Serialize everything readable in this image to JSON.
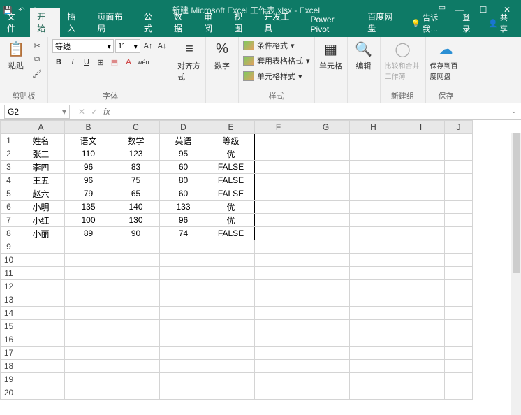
{
  "title": "新建 Microsoft Excel 工作表.xlsx - Excel",
  "tabs": [
    "文件",
    "开始",
    "插入",
    "页面布局",
    "公式",
    "数据",
    "审阅",
    "视图",
    "开发工具",
    "Power Pivot",
    "百度网盘"
  ],
  "active_tab": 1,
  "tell_me": "告诉我…",
  "login": "登录",
  "share": "共享",
  "ribbon": {
    "clipboard": {
      "paste": "粘贴",
      "label": "剪贴板"
    },
    "font": {
      "name": "等线",
      "size": "11",
      "label": "字体"
    },
    "align": {
      "big": "对齐方式"
    },
    "number": {
      "big": "数字"
    },
    "styles": {
      "c1": "条件格式",
      "c2": "套用表格格式",
      "c3": "单元格样式",
      "label": "样式"
    },
    "cells": {
      "big": "单元格"
    },
    "editing": {
      "big": "编辑"
    },
    "newgrp": {
      "big": "比较和合并工作簿",
      "label": "新建组"
    },
    "save": {
      "big": "保存到百度网盘",
      "label": "保存"
    }
  },
  "namebox": "G2",
  "columns": [
    "A",
    "B",
    "C",
    "D",
    "E",
    "F",
    "G",
    "H",
    "I",
    "J"
  ],
  "row_count": 20,
  "data": {
    "1": [
      "姓名",
      "语文",
      "数学",
      "英语",
      "等级"
    ],
    "2": [
      "张三",
      "110",
      "123",
      "95",
      "优"
    ],
    "3": [
      "李四",
      "96",
      "83",
      "60",
      "FALSE"
    ],
    "4": [
      "王五",
      "96",
      "75",
      "80",
      "FALSE"
    ],
    "5": [
      "赵六",
      "79",
      "65",
      "60",
      "FALSE"
    ],
    "6": [
      "小明",
      "135",
      "140",
      "133",
      "优"
    ],
    "7": [
      "小红",
      "100",
      "130",
      "96",
      "优"
    ],
    "8": [
      "小丽",
      "89",
      "90",
      "74",
      "FALSE"
    ]
  },
  "chart_data": {
    "type": "table",
    "columns": [
      "姓名",
      "语文",
      "数学",
      "英语",
      "等级"
    ],
    "rows": [
      [
        "张三",
        110,
        123,
        95,
        "优"
      ],
      [
        "李四",
        96,
        83,
        60,
        "FALSE"
      ],
      [
        "王五",
        96,
        75,
        80,
        "FALSE"
      ],
      [
        "赵六",
        79,
        65,
        60,
        "FALSE"
      ],
      [
        "小明",
        135,
        140,
        133,
        "优"
      ],
      [
        "小红",
        100,
        130,
        96,
        "优"
      ],
      [
        "小丽",
        89,
        90,
        74,
        "FALSE"
      ]
    ]
  }
}
